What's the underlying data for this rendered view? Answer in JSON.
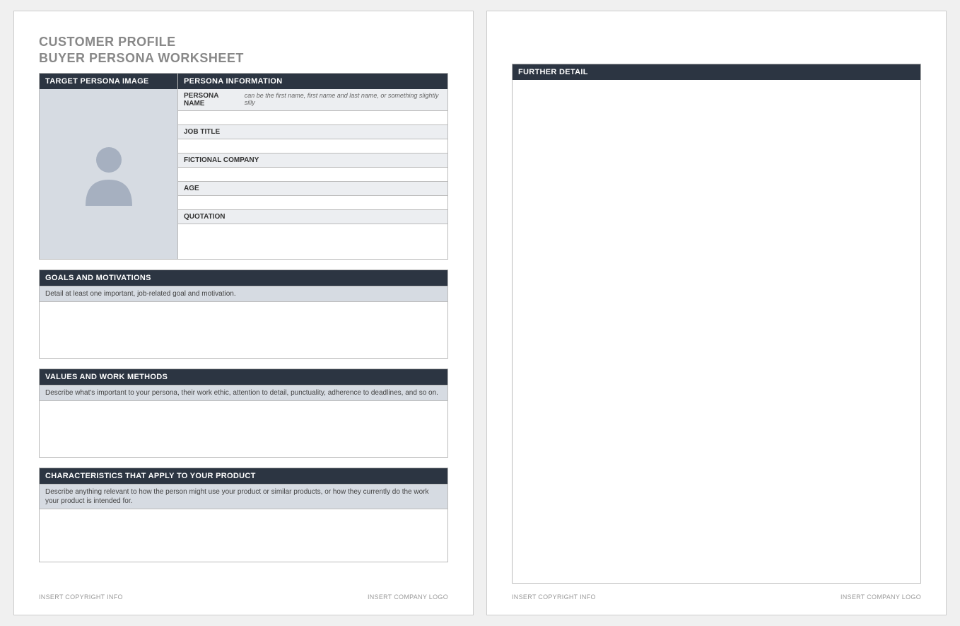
{
  "title_line1": "CUSTOMER PROFILE",
  "title_line2": "BUYER PERSONA WORKSHEET",
  "top": {
    "image_header": "TARGET PERSONA IMAGE",
    "info_header": "PERSONA INFORMATION",
    "fields": {
      "persona_name": {
        "label": "PERSONA NAME",
        "hint": "can be the first name, first name and last name, or something slightly silly"
      },
      "job_title": {
        "label": "JOB TITLE"
      },
      "fictional_company": {
        "label": "FICTIONAL COMPANY"
      },
      "age": {
        "label": "AGE"
      },
      "quotation": {
        "label": "QUOTATION"
      }
    }
  },
  "sections": {
    "goals": {
      "header": "GOALS AND MOTIVATIONS",
      "hint": "Detail at least one important, job-related goal and motivation."
    },
    "values": {
      "header": "VALUES AND WORK METHODS",
      "hint": "Describe what's important to your persona, their work ethic, attention to detail, punctuality, adherence to deadlines, and so on."
    },
    "characteristics": {
      "header": "CHARACTERISTICS THAT APPLY TO YOUR PRODUCT",
      "hint": "Describe anything relevant to how the person might use your product or similar products, or how they currently do the work your product is intended for."
    },
    "further_detail": {
      "header": "FURTHER DETAIL"
    }
  },
  "footer": {
    "copyright": "INSERT COPYRIGHT INFO",
    "logo": "INSERT COMPANY LOGO"
  }
}
